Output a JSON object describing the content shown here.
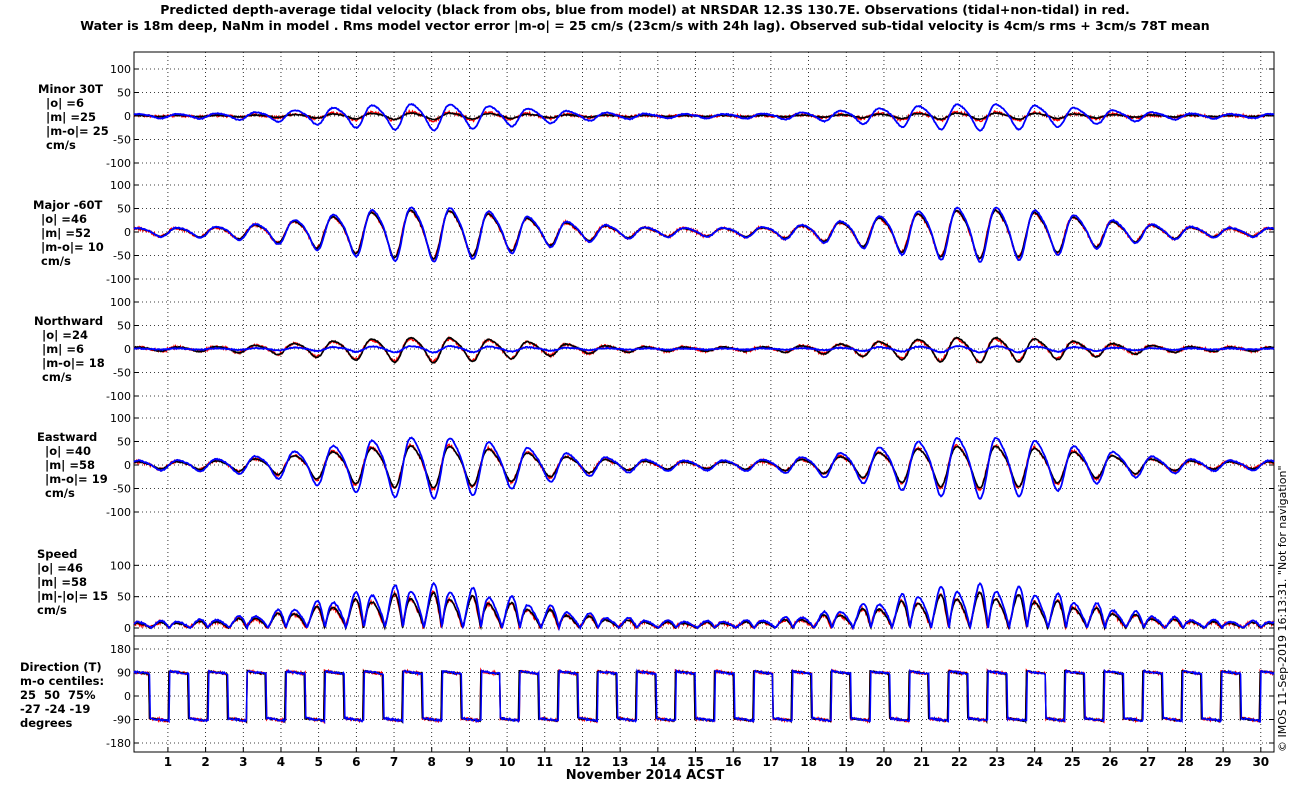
{
  "title_lines": [
    "Predicted depth-average tidal velocity (black from obs, blue from model) at NRSDAR 12.3S 130.7E. Observations (tidal+non-tidal) in red.",
    "Water is 18m deep, NaNm in model . Rms model vector error |m-o| = 25 cm/s (23cm/s with 24h lag). Observed sub-tidal velocity is 4cm/s rms + 3cm/s 78T mean"
  ],
  "watermark": "© IMOS 11-Sep-2019 16:13:31. \"Not for navigation\"",
  "chart_data": {
    "type": "line",
    "xlabel": "November 2014 ACST",
    "x_ticks": [
      "1",
      "2",
      "3",
      "4",
      "5",
      "6",
      "7",
      "8",
      "9",
      "10",
      "11",
      "12",
      "13",
      "14",
      "15",
      "16",
      "17",
      "18",
      "19",
      "20",
      "21",
      "22",
      "23",
      "24",
      "25",
      "26",
      "27",
      "28",
      "29",
      "30"
    ],
    "xlim": [
      0.1,
      30.35
    ],
    "series_colors": {
      "obs_tidal": "#000000",
      "model": "#0000ff",
      "observed": "#ff0000"
    },
    "panels": [
      {
        "name": "minor",
        "label_lines": [
          "Minor 30T",
          "|o| =6",
          "|m| =25",
          "|m-o|= 25",
          "cm/s"
        ],
        "ylim": [
          -100,
          100
        ],
        "yticks": [
          "100",
          "50",
          "0",
          "-50",
          "-100"
        ],
        "amps": {
          "obs": 6,
          "model": 25,
          "red": 8
        }
      },
      {
        "name": "major",
        "label_lines": [
          "Major -60T",
          "|o| =46",
          "|m| =52",
          "|m-o|= 10",
          "cm/s"
        ],
        "ylim": [
          -100,
          100
        ],
        "yticks": [
          "100",
          "50",
          "0",
          "-50",
          "-100"
        ],
        "amps": {
          "obs": 46,
          "model": 52,
          "red": 46
        }
      },
      {
        "name": "northward",
        "label_lines": [
          "Northward",
          "|o| =24",
          "|m| =6",
          "|m-o|= 18",
          "cm/s"
        ],
        "ylim": [
          -100,
          100
        ],
        "yticks": [
          "100",
          "50",
          "0",
          "-50",
          "-100"
        ],
        "amps": {
          "obs": 24,
          "model": 6,
          "red": 22
        }
      },
      {
        "name": "eastward",
        "label_lines": [
          "Eastward",
          "|o| =40",
          "|m| =58",
          "|m-o|= 19",
          "cm/s"
        ],
        "ylim": [
          -100,
          100
        ],
        "yticks": [
          "100",
          "50",
          "0",
          "-50",
          "-100"
        ],
        "amps": {
          "obs": 40,
          "model": 58,
          "red": 42
        }
      },
      {
        "name": "speed",
        "label_lines": [
          "Speed",
          "|o| =46",
          "|m| =58",
          "|m|-|o|= 15",
          "cm/s"
        ],
        "ylim": [
          0,
          150
        ],
        "yticks": [
          "100",
          "50",
          "0"
        ],
        "amps": {
          "obs": 46,
          "model": 58,
          "red": 46
        }
      },
      {
        "name": "direction",
        "label_lines": [
          "Direction (T)",
          "m-o centiles:",
          "25  50  75%",
          "-27 -24 -19",
          "degrees"
        ],
        "ylim": [
          -180,
          180
        ],
        "yticks": [
          "180",
          "90",
          "0",
          "-90",
          "-180"
        ]
      }
    ]
  }
}
